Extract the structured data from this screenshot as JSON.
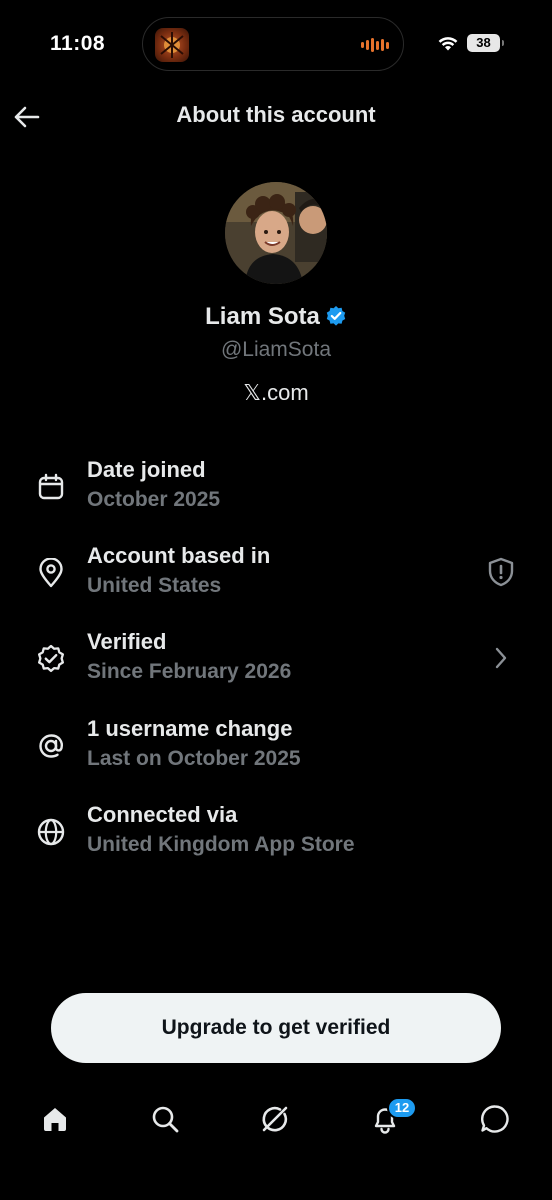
{
  "status_bar": {
    "time": "11:08",
    "battery": "38",
    "accent_color": "#e8732c"
  },
  "header": {
    "title": "About this account",
    "back_icon": "arrow-left-icon"
  },
  "profile": {
    "name": "Liam Sota",
    "handle": "@LiamSota",
    "site": "𝕏.com",
    "verified_color": "#1d9bf0"
  },
  "info": {
    "joined": {
      "icon": "calendar-icon",
      "title": "Date joined",
      "value": "October 2025"
    },
    "based": {
      "icon": "location-pin-icon",
      "title": "Account based in",
      "value": "United States",
      "trailing_icon": "shield-alert-icon"
    },
    "verified": {
      "icon": "verified-badge-icon",
      "title": "Verified",
      "value": "Since February 2026",
      "trailing_icon": "chevron-right-icon"
    },
    "username": {
      "icon": "at-sign-icon",
      "title": "1 username change",
      "value": "Last on October 2025"
    },
    "connected": {
      "icon": "globe-icon",
      "title": "Connected via",
      "value": "United Kingdom App Store"
    }
  },
  "cta": {
    "label": "Upgrade to get verified"
  },
  "tabbar": {
    "items": [
      "home-icon",
      "search-icon",
      "grok-icon",
      "notifications-icon",
      "messages-icon"
    ],
    "notifications_badge": "12",
    "badge_color": "#1d9bf0"
  }
}
